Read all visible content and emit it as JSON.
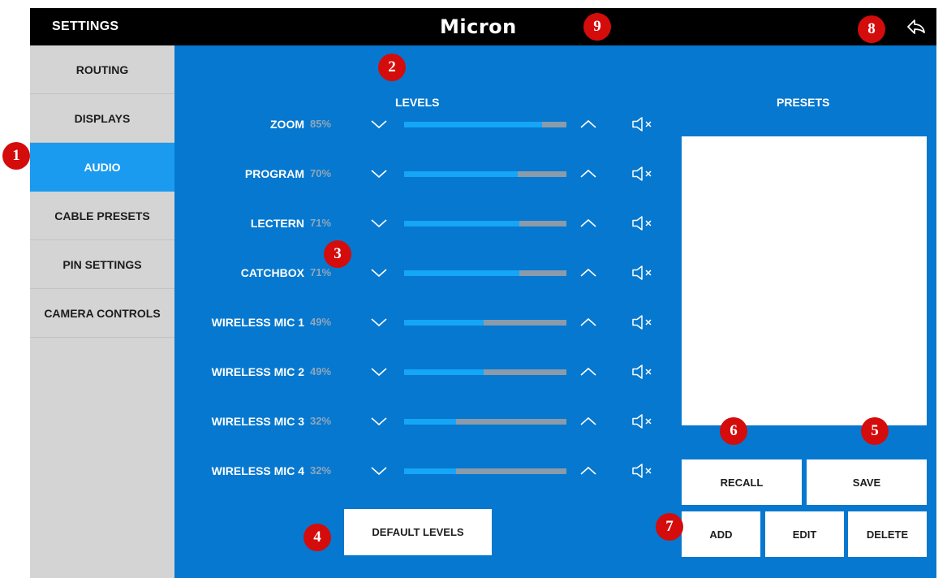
{
  "header": {
    "title": "SETTINGS",
    "logo_text": "Micron"
  },
  "sidebar": {
    "items": [
      {
        "label": "ROUTING",
        "active": false
      },
      {
        "label": "DISPLAYS",
        "active": false
      },
      {
        "label": "AUDIO",
        "active": true
      },
      {
        "label": "CABLE PRESETS",
        "active": false
      },
      {
        "label": "PIN SETTINGS",
        "active": false
      },
      {
        "label": "CAMERA CONTROLS",
        "active": false
      }
    ]
  },
  "levels": {
    "heading": "LEVELS",
    "channels": [
      {
        "name": "ZOOM",
        "percent": "85%",
        "level": 0.85
      },
      {
        "name": "PROGRAM",
        "percent": "70%",
        "level": 0.7
      },
      {
        "name": "LECTERN",
        "percent": "71%",
        "level": 0.71
      },
      {
        "name": "CATCHBOX",
        "percent": "71%",
        "level": 0.71
      },
      {
        "name": "WIRELESS MIC 1",
        "percent": "49%",
        "level": 0.49
      },
      {
        "name": "WIRELESS MIC 2",
        "percent": "49%",
        "level": 0.49
      },
      {
        "name": "WIRELESS MIC 3",
        "percent": "32%",
        "level": 0.32
      },
      {
        "name": "WIRELESS MIC 4",
        "percent": "32%",
        "level": 0.32
      }
    ],
    "default_button": "DEFAULT LEVELS"
  },
  "presets": {
    "heading": "PRESETS",
    "recall": "RECALL",
    "save": "SAVE",
    "add": "ADD",
    "edit": "EDIT",
    "delete": "DELETE"
  },
  "badges": [
    "1",
    "2",
    "3",
    "4",
    "5",
    "6",
    "7",
    "8",
    "9"
  ],
  "colors": {
    "top_bar": "#000000",
    "main_panel": "#0678cf",
    "sidebar": "#d4d4d4",
    "active_nav": "#1a9bf0",
    "slider_fill": "#15a6f7",
    "slider_track": "#8a9bab",
    "badge": "#d40c0c"
  },
  "icons": {
    "back": "reply-arrow-icon",
    "volume_down": "chevron-down-icon",
    "volume_up": "chevron-up-icon",
    "mute": "speaker-mute-icon"
  }
}
